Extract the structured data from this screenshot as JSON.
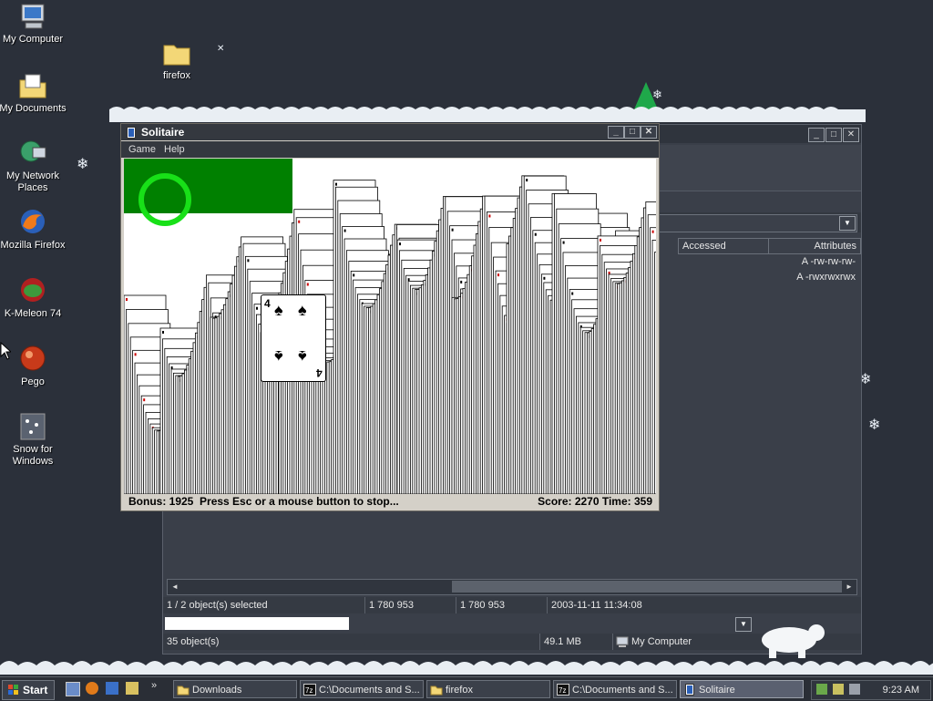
{
  "desktop": {
    "icons": [
      {
        "label": "My Computer",
        "icon": "my-computer-icon"
      },
      {
        "label": "firefox",
        "icon": "folder-icon"
      },
      {
        "label": "My Documents",
        "icon": "my-documents-icon"
      },
      {
        "label": "My Network Places",
        "icon": "network-places-icon"
      },
      {
        "label": "Mozilla Firefox",
        "icon": "firefox-icon"
      },
      {
        "label": "K-Meleon 74",
        "icon": "k-meleon-icon"
      },
      {
        "label": "Pego",
        "icon": "pego-icon"
      },
      {
        "label": "Snow for Windows",
        "icon": "snow-icon"
      }
    ]
  },
  "explorer": {
    "columns": {
      "accessed": "Accessed",
      "attributes": "Attributes"
    },
    "rows": [
      {
        "attributes": "A -rw-rw-rw-"
      },
      {
        "attributes": "A -rwxrwxrwx"
      }
    ],
    "status": {
      "selected": "1 / 2 object(s) selected",
      "size1": "1 780 953",
      "size2": "1 780 953",
      "date": "2003-11-11 11:34:08"
    },
    "status2": {
      "objects": "35 object(s)",
      "size": "49.1 MB",
      "location": "My Computer"
    }
  },
  "solitaire": {
    "title": "Solitaire",
    "menu": [
      "Game",
      "Help"
    ],
    "card": {
      "rank": "4",
      "suit": "♠"
    },
    "status_left": "Bonus: 1925  Press Esc or a mouse button to stop...",
    "status_right": "Score: 2270 Time: 359"
  },
  "taskbar": {
    "start": "Start",
    "buttons": [
      {
        "label": "Downloads",
        "icon": "folder-icon"
      },
      {
        "label": "C:\\Documents and S...",
        "icon": "7zip-icon"
      },
      {
        "label": "firefox",
        "icon": "folder-icon"
      },
      {
        "label": "C:\\Documents and S...",
        "icon": "7zip-icon"
      },
      {
        "label": "Solitaire",
        "icon": "solitaire-icon"
      }
    ],
    "clock": "9:23 AM"
  },
  "colors": {
    "desktop": "#2b303a",
    "felt_green": "#008000",
    "card_red": "#cc0000"
  }
}
